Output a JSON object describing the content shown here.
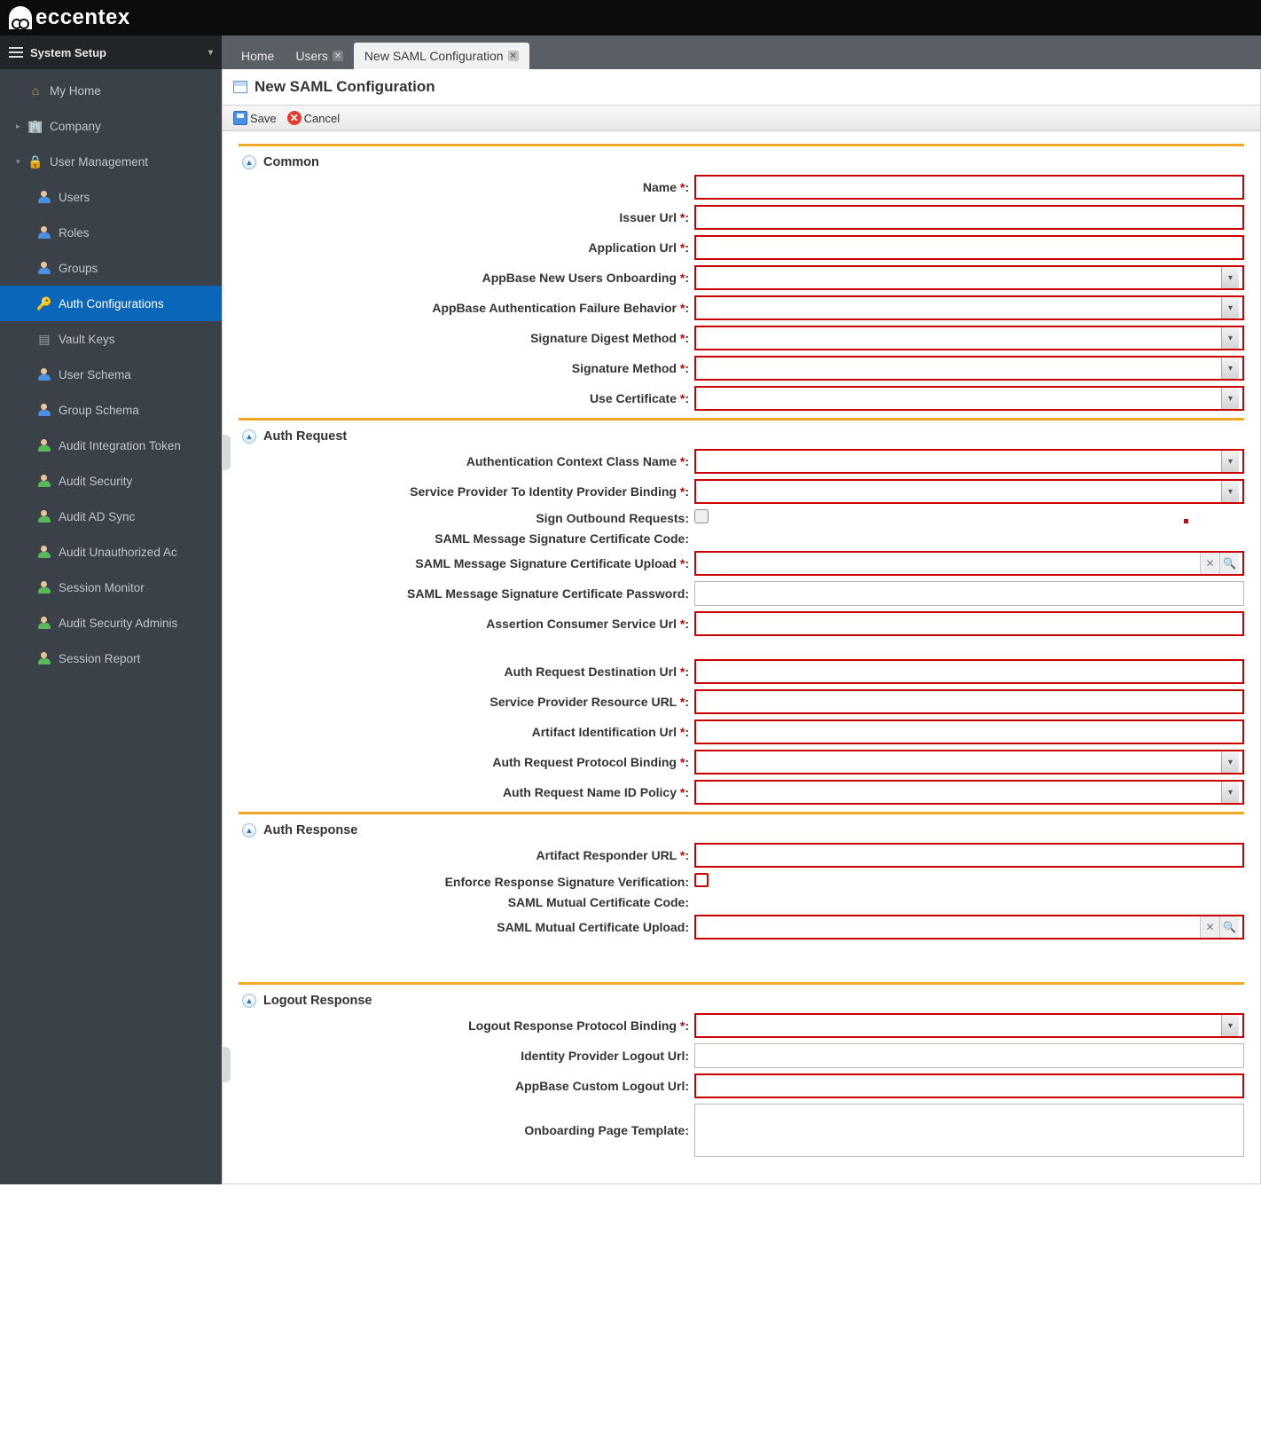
{
  "brand": "eccentex",
  "sidebar": {
    "header": "System Setup",
    "items": [
      {
        "label": "My Home",
        "icon": "home"
      },
      {
        "label": "Company",
        "icon": "building"
      },
      {
        "label": "User Management",
        "icon": "lock"
      },
      {
        "label": "Users",
        "icon": "person"
      },
      {
        "label": "Roles",
        "icon": "person"
      },
      {
        "label": "Groups",
        "icon": "person"
      },
      {
        "label": "Auth Configurations",
        "icon": "key",
        "active": true
      },
      {
        "label": "Vault Keys",
        "icon": "vault"
      },
      {
        "label": "User Schema",
        "icon": "person"
      },
      {
        "label": "Group Schema",
        "icon": "person"
      },
      {
        "label": "Audit Integration Token",
        "icon": "person-g"
      },
      {
        "label": "Audit Security",
        "icon": "person-g"
      },
      {
        "label": "Audit AD Sync",
        "icon": "person-g"
      },
      {
        "label": "Audit Unauthorized Ac",
        "icon": "person-g"
      },
      {
        "label": "Session Monitor",
        "icon": "person-g"
      },
      {
        "label": "Audit Security Adminis",
        "icon": "person-g"
      },
      {
        "label": "Session Report",
        "icon": "person-g"
      }
    ]
  },
  "tabs": [
    {
      "label": "Home",
      "closable": false
    },
    {
      "label": "Users",
      "closable": true
    },
    {
      "label": "New SAML Configuration",
      "closable": true,
      "active": true
    }
  ],
  "page": {
    "title": "New SAML Configuration",
    "toolbar": {
      "save": "Save",
      "cancel": "Cancel"
    },
    "sections": {
      "common": {
        "title": "Common",
        "fields": {
          "name": "Name",
          "issuer": "Issuer Url",
          "appurl": "Application Url",
          "onboard": "AppBase New Users Onboarding",
          "failbeh": "AppBase Authentication Failure Behavior",
          "digest": "Signature Digest Method",
          "sigmethod": "Signature Method",
          "usecert": "Use Certificate"
        }
      },
      "authreq": {
        "title": "Auth Request",
        "fields": {
          "ctxclass": "Authentication Context Class Name",
          "sp2idp": "Service Provider To Identity Provider Binding",
          "signout": "Sign Outbound Requests:",
          "sigcode": "SAML Message Signature Certificate Code:",
          "sigupload": "SAML Message Signature Certificate Upload",
          "sigpass": "SAML Message Signature Certificate Password:",
          "acs": "Assertion Consumer Service Url",
          "desturl": "Auth Request Destination Url",
          "spres": "Service Provider Resource URL",
          "artifact": "Artifact Identification Url",
          "protbind": "Auth Request Protocol Binding",
          "nameid": "Auth Request Name ID Policy"
        }
      },
      "authresp": {
        "title": "Auth Response",
        "fields": {
          "artresp": "Artifact Responder URL",
          "enforce": "Enforce Response Signature Verification:",
          "mutcode": "SAML Mutual Certificate Code:",
          "mutupload": "SAML Mutual Certificate Upload:"
        }
      },
      "logout": {
        "title": "Logout Response",
        "fields": {
          "protbind": "Logout Response Protocol Binding",
          "idplogout": "Identity Provider Logout Url:",
          "customlogout": "AppBase Custom Logout Url:",
          "onboardtpl": "Onboarding Page Template:"
        }
      }
    }
  }
}
